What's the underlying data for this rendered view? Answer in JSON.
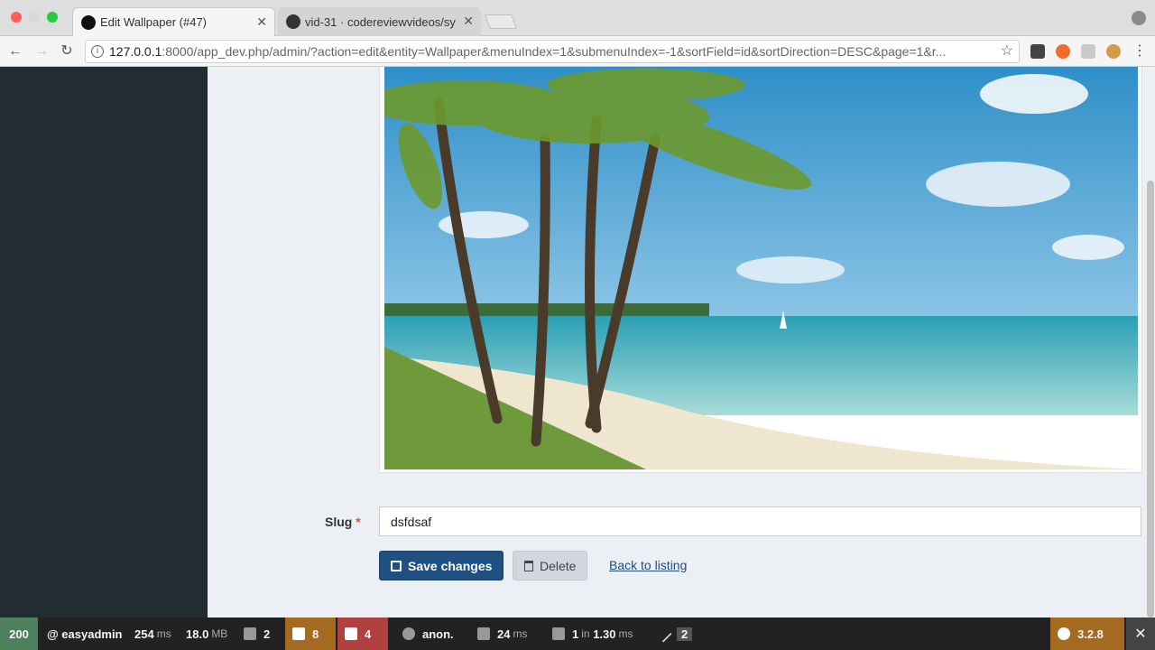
{
  "browser": {
    "tabs": [
      {
        "label": "Edit Wallpaper (#47)",
        "active": true
      },
      {
        "label": "vid-31 · codereviewvideos/sy",
        "active": false
      }
    ],
    "url_host": "127.0.0.1",
    "url_rest": ":8000/app_dev.php/admin/?action=edit&entity=Wallpaper&menuIndex=1&submenuIndex=-1&sortField=id&sortDirection=DESC&page=1&r..."
  },
  "form": {
    "slug_label": "Slug",
    "required_mark": "*",
    "slug_value": "dsfdsaf",
    "save_label": "Save changes",
    "delete_label": "Delete",
    "back_label": "Back to listing"
  },
  "profiler": {
    "status": "200",
    "route": "@ easyadmin",
    "time": "254",
    "time_unit": "ms",
    "memory": "18.0",
    "memory_unit": "MB",
    "forms": "2",
    "logs": "8",
    "translations": "4",
    "user": "anon.",
    "render_time": "24",
    "render_unit": "ms",
    "db_queries": "1",
    "db_in": "in",
    "db_time": "1.30",
    "db_unit": "ms",
    "config": "2",
    "version": "3.2.8"
  },
  "colors": {
    "sidebar": "#222d32",
    "primary": "#205081",
    "status_ok": "#4f805d",
    "logs": "#a46a1f",
    "translations": "#b0413e",
    "symfony": "#a46a1f"
  }
}
